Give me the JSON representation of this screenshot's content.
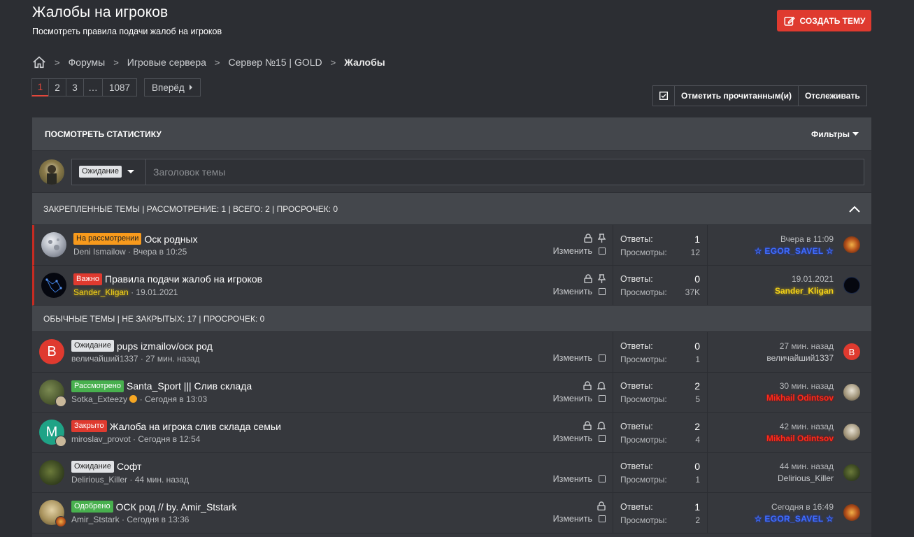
{
  "page": {
    "title": "Жалобы на игроков",
    "subtitle": "Посмотреть правила подачи жалоб на игроков",
    "create_button": "СОЗДАТЬ ТЕМУ"
  },
  "breadcrumb": [
    "Форумы",
    "Игровые сервера",
    "Сервер №15 | GOLD",
    "Жалобы"
  ],
  "pagination": {
    "pages": [
      "1",
      "2",
      "3",
      "…",
      "1087"
    ],
    "current": "1",
    "next": "Вперёд"
  },
  "actions": {
    "mark_read": "Отметить прочитанным(и)",
    "watch": "Отслеживать"
  },
  "statbar": {
    "stats": "ПОСМОТРЕТЬ СТАТИСТИКУ",
    "filters": "Фильтры"
  },
  "quick": {
    "prefix": "Ожидание",
    "placeholder": "Заголовок темы"
  },
  "sections": {
    "sticky": "ЗАКРЕПЛЕННЫЕ ТЕМЫ | РАССМОТРЕНИЕ: 1 | ВСЕГО: 2 | ПРОСРОЧЕК: 0",
    "normal": "ОБЫЧНЫЕ ТЕМЫ | НЕ ЗАКРЫТЫХ: 17 | ПРОСРОЧЕК: 0"
  },
  "labels": {
    "replies": "Ответы:",
    "views": "Просмотры:",
    "edit": "Изменить"
  },
  "sticky_threads": [
    {
      "tag": "На рассмотрении",
      "title": "Оск родных",
      "author": "Deni Ismailow",
      "date": "Вчера в 10:25",
      "replies": "1",
      "views": "12",
      "last_date": "Вчера в 11:09",
      "last_user": "☆ EGOR_SAVEL ☆"
    },
    {
      "tag": "Важно",
      "title": "Правила подачи жалоб на игроков",
      "author": "Sander_Kligan",
      "date": "19.01.2021",
      "replies": "0",
      "views": "37K",
      "last_date": "19.01.2021",
      "last_user": "Sander_Kligan"
    }
  ],
  "threads": [
    {
      "tag": "Ожидание",
      "title": "pups izmailov/оск род",
      "author": "величайший1337",
      "date": "27 мин. назад",
      "replies": "0",
      "views": "1",
      "last_date": "27 мин. назад",
      "last_user": "величайший1337",
      "avatar_letter": "В"
    },
    {
      "tag": "Рассмотрено",
      "title": "Santa_Sport ||| Слив склада",
      "author": "Sotka_Exteezy",
      "date": "Сегодня в 13:03",
      "replies": "2",
      "views": "5",
      "last_date": "30 мин. назад",
      "last_user": "Mikhail Odintsov"
    },
    {
      "tag": "Закрыто",
      "title": "Жалоба на игрока слив склада семьи",
      "author": "miroslav_provot",
      "date": "Сегодня в 12:54",
      "replies": "2",
      "views": "4",
      "last_date": "42 мин. назад",
      "last_user": "Mikhail Odintsov",
      "avatar_letter": "M"
    },
    {
      "tag": "Ожидание",
      "title": "Софт",
      "author": "Delirious_Killer",
      "date": "44 мин. назад",
      "replies": "0",
      "views": "1",
      "last_date": "44 мин. назад",
      "last_user": "Delirious_Killer"
    },
    {
      "tag": "Одобрено",
      "title": "ОСК род // by. Amir_Ststark",
      "author": "Amir_Ststark",
      "date": "Сегодня в 13:36",
      "replies": "1",
      "views": "2",
      "last_date": "Сегодня в 16:49",
      "last_user": "☆ EGOR_SAVEL ☆"
    }
  ],
  "colors": {
    "accent": "#df3a2f",
    "background": "#2c2e33",
    "panel": "#36383d",
    "bar": "#44474c",
    "blue_user": "#3f6dff",
    "gold_user": "#f3d21a",
    "red_user": "#ff2a1a"
  }
}
